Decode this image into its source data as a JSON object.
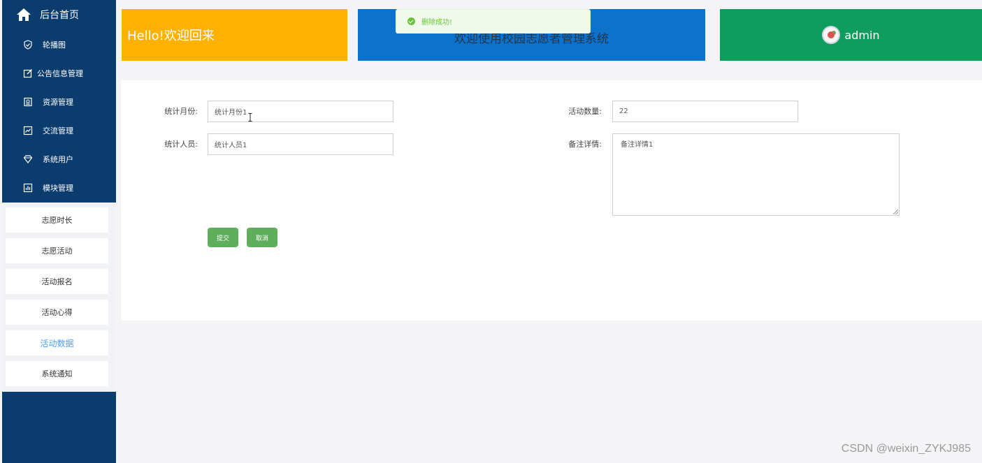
{
  "sidebar": {
    "home_label": "后台首页",
    "items": [
      {
        "label": "轮播图",
        "icon": "shield-icon"
      },
      {
        "label": "公告信息管理",
        "icon": "edit-icon"
      },
      {
        "label": "资源管理",
        "icon": "badge-icon"
      },
      {
        "label": "交流管理",
        "icon": "chart-line-icon"
      },
      {
        "label": "系统用户",
        "icon": "diamond-icon"
      },
      {
        "label": "模块管理",
        "icon": "bar-chart-icon"
      }
    ],
    "sub_items": [
      {
        "label": "志愿时长",
        "active": false
      },
      {
        "label": "志愿活动",
        "active": false
      },
      {
        "label": "活动报名",
        "active": false
      },
      {
        "label": "活动心得",
        "active": false
      },
      {
        "label": "活动数据",
        "active": true
      },
      {
        "label": "系统通知",
        "active": false
      }
    ]
  },
  "header": {
    "hello": "Hello!欢迎回来",
    "welcome": "欢迎使用校园志愿者管理系统",
    "username": "admin"
  },
  "toast": {
    "message": "删除成功!",
    "type": "success"
  },
  "form": {
    "month_label": "统计月份:",
    "month_value": "统计月份1",
    "staff_label": "统计人员:",
    "staff_value": "统计人员1",
    "count_label": "活动数量:",
    "count_value": "22",
    "remark_label": "备注详情:",
    "remark_value": "备注详情1",
    "submit_label": "提交",
    "cancel_label": "取消"
  },
  "watermark": "CSDN @weixin_ZYKJ985",
  "colors": {
    "sidebar_bg": "#0b3c6e",
    "hello_tile": "#ffb100",
    "welcome_tile": "#0c72cc",
    "admin_tile": "#0f9d5e",
    "button": "#5fae5c",
    "active_sub": "#4a9ff0"
  }
}
